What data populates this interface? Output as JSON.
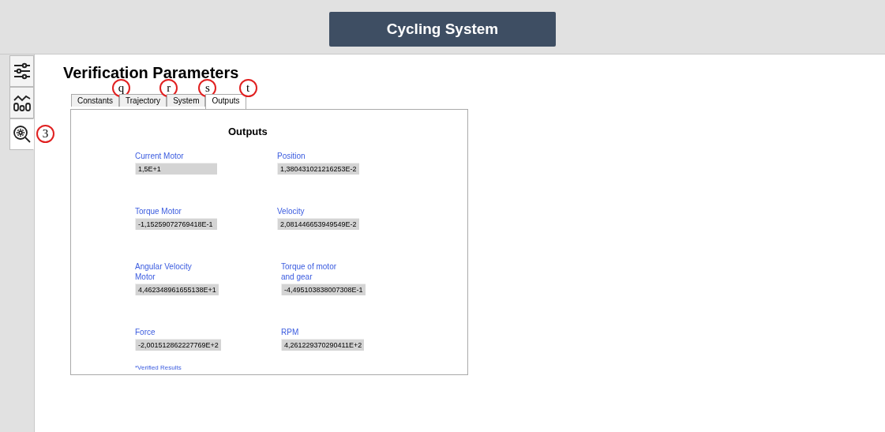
{
  "header": {
    "title": "Cycling System"
  },
  "sidebar": {
    "items": [
      {
        "kind": "sliders",
        "selected": false
      },
      {
        "kind": "chart",
        "selected": false
      },
      {
        "kind": "inspect",
        "selected": true,
        "callout": "3"
      }
    ]
  },
  "page": {
    "title": "Verification Parameters"
  },
  "tabs": [
    {
      "label": "Constants",
      "selected": false,
      "callout": "q"
    },
    {
      "label": "Trajectory",
      "selected": false,
      "callout": "r"
    },
    {
      "label": "System",
      "selected": false,
      "callout": "s"
    },
    {
      "label": "Outputs",
      "selected": true,
      "callout": "t"
    }
  ],
  "panel": {
    "title": "Outputs",
    "note": "*Verified Results",
    "fields": [
      {
        "label": "Current Motor",
        "value": "1,5E+1"
      },
      {
        "label": "Position",
        "value": "1,380431021216253E-2"
      },
      {
        "label": "Torque Motor",
        "value": "-1,15259072769418E-1"
      },
      {
        "label": "Velocity",
        "value": "2,081446653949549E-2"
      },
      {
        "label": "Angular Velocity\nMotor",
        "value": "4,462348961655138E+1"
      },
      {
        "label": "Torque of motor\nand gear",
        "value": "-4,495103838007308E-1"
      },
      {
        "label": "Force",
        "value": "-2,001512862227769E+2"
      },
      {
        "label": "RPM",
        "value": "4,261229370290411E+2"
      }
    ]
  }
}
